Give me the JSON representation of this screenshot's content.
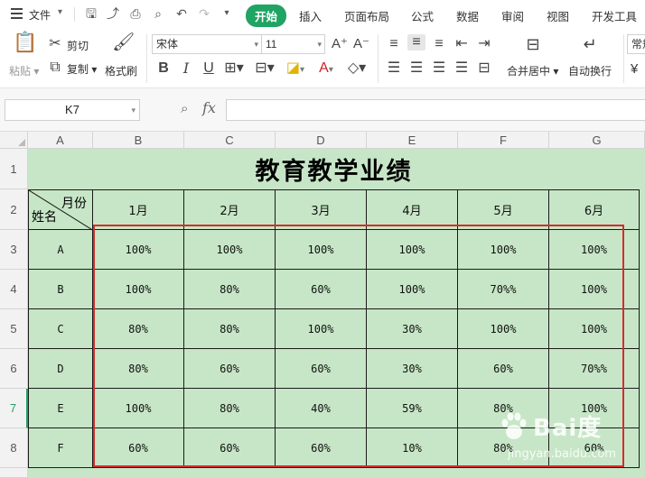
{
  "menubar": {
    "file_label": "文件",
    "tabs": [
      {
        "label": "开始",
        "active": true
      },
      {
        "label": "插入"
      },
      {
        "label": "页面布局"
      },
      {
        "label": "公式"
      },
      {
        "label": "数据"
      },
      {
        "label": "审阅"
      },
      {
        "label": "视图"
      },
      {
        "label": "开发工具"
      }
    ]
  },
  "ribbon": {
    "paste_label": "粘贴",
    "cut_label": "剪切",
    "copy_label": "复制",
    "format_painter_label": "格式刷",
    "font_name": "宋体",
    "font_size": "11",
    "merge_center_label": "合并居中",
    "wrap_text_label": "自动换行",
    "style_label": "常规",
    "currency_symbol": "¥"
  },
  "formula_bar": {
    "name_box": "K7",
    "fx_label": "fx",
    "value": ""
  },
  "sheet": {
    "columns": [
      "A",
      "B",
      "C",
      "D",
      "E",
      "F",
      "G"
    ],
    "rows": [
      "1",
      "2",
      "3",
      "4",
      "5",
      "6",
      "7",
      "8"
    ],
    "selected_row": "7",
    "title": "教育教学业绩",
    "header_corner_top": "月份",
    "header_corner_bottom": "姓名",
    "month_headers": [
      "1月",
      "2月",
      "3月",
      "4月",
      "5月",
      "6月"
    ],
    "data_rows": [
      {
        "name": "A",
        "values": [
          "100%",
          "100%",
          "100%",
          "100%",
          "100%",
          "100%"
        ]
      },
      {
        "name": "B",
        "values": [
          "100%",
          "80%",
          "60%",
          "100%",
          "70%%",
          "100%"
        ]
      },
      {
        "name": "C",
        "values": [
          "80%",
          "80%",
          "100%",
          "30%",
          "100%",
          "100%"
        ]
      },
      {
        "name": "D",
        "values": [
          "80%",
          "60%",
          "60%",
          "30%",
          "60%",
          "70%%"
        ]
      },
      {
        "name": "E",
        "values": [
          "100%",
          "80%",
          "40%",
          "59%",
          "80%",
          "100%"
        ]
      },
      {
        "name": "F",
        "values": [
          "60%",
          "60%",
          "60%",
          "10%",
          "80%",
          "60%"
        ]
      }
    ]
  },
  "watermark": {
    "brand": "Bai度",
    "sub": "jingyan.baidu.com"
  },
  "colors": {
    "accent": "#1fa463",
    "cell_fill": "#c7e6c7",
    "highlight_border": "#d92b2b"
  }
}
